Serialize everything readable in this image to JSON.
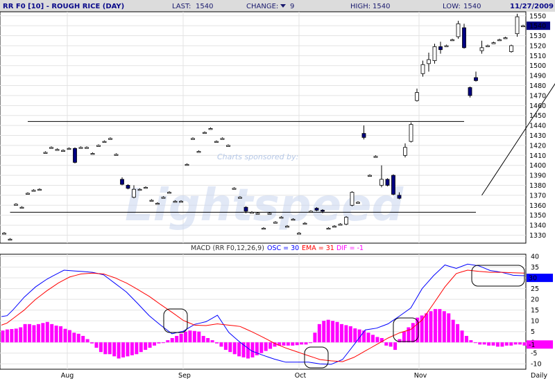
{
  "header": {
    "title": "RR F0 [10] - ROUGH RICE (DAY)",
    "last_label": "LAST:",
    "last_value": "1540",
    "change_label": "CHANGE:",
    "change_value": "9",
    "change_direction": "down",
    "high_label": "HIGH:",
    "high_value": "1540",
    "low_label": "LOW:",
    "low_value": "1540",
    "date": "11/27/2009"
  },
  "watermark": {
    "sponsor": "Charts sponsored by:",
    "brand": "Lightspeed"
  },
  "macd_legend": {
    "prefix": "MACD (RR F0,12,26,9)",
    "osc": "OSC = 30",
    "ema": "EMA = 31",
    "dif": "DIF = -1"
  },
  "colors": {
    "header_bg": "#dcdcdc",
    "up_candle": "#ffffff",
    "down_candle": "#000080",
    "macd_line": "#0000ff",
    "signal_line": "#ff0000",
    "histogram": "#ff00ff",
    "current_price_box": "#000080"
  },
  "chart_data": [
    {
      "type": "candlestick",
      "title": "RR F0 [10] - ROUGH RICE (DAY)",
      "y_ticks": [
        1330,
        1340,
        1350,
        1360,
        1370,
        1380,
        1390,
        1400,
        1410,
        1420,
        1430,
        1440,
        1450,
        1460,
        1470,
        1480,
        1490,
        1500,
        1510,
        1520,
        1530,
        1540,
        1550
      ],
      "ylim": [
        1322,
        1554
      ],
      "x_tick_labels": [
        "Aug",
        "Sep",
        "Oct",
        "Nov",
        "Daily"
      ],
      "current_price_label": "1540",
      "trendlines": [
        {
          "name": "resistance",
          "from": {
            "bar": 4,
            "price": 1444
          },
          "to": {
            "bar": 78,
            "price": 1444
          }
        },
        {
          "name": "support",
          "from": {
            "bar": 1,
            "price": 1353
          },
          "to": {
            "bar": 80,
            "price": 1353
          }
        },
        {
          "name": "uptrend",
          "from": {
            "bar": 81,
            "price": 1370
          },
          "to": {
            "bar": 99,
            "price": 1532
          }
        }
      ],
      "candles": [
        {
          "o": 1332,
          "h": 1333,
          "l": 1331,
          "c": 1332
        },
        {
          "o": 1326,
          "h": 1327,
          "l": 1325,
          "c": 1326
        },
        {
          "o": 1361,
          "h": 1362,
          "l": 1360,
          "c": 1361
        },
        {
          "o": 1358,
          "h": 1359,
          "l": 1357,
          "c": 1358
        },
        {
          "o": 1372,
          "h": 1373,
          "l": 1371,
          "c": 1372
        },
        {
          "o": 1375,
          "h": 1376,
          "l": 1374,
          "c": 1375
        },
        {
          "o": 1376,
          "h": 1377,
          "l": 1375,
          "c": 1376
        },
        {
          "o": 1413,
          "h": 1414,
          "l": 1412,
          "c": 1413
        },
        {
          "o": 1418,
          "h": 1419,
          "l": 1417,
          "c": 1418
        },
        {
          "o": 1416,
          "h": 1417,
          "l": 1415,
          "c": 1416
        },
        {
          "o": 1415,
          "h": 1416,
          "l": 1414,
          "c": 1415
        },
        {
          "o": 1417,
          "h": 1418,
          "l": 1416,
          "c": 1417
        },
        {
          "o": 1417,
          "h": 1418,
          "l": 1402,
          "c": 1403
        },
        {
          "o": 1418,
          "h": 1419,
          "l": 1417,
          "c": 1418
        },
        {
          "o": 1418,
          "h": 1419,
          "l": 1417,
          "c": 1418
        },
        {
          "o": 1412,
          "h": 1413,
          "l": 1411,
          "c": 1412
        },
        {
          "o": 1420,
          "h": 1421,
          "l": 1419,
          "c": 1420
        },
        {
          "o": 1424,
          "h": 1425,
          "l": 1423,
          "c": 1424
        },
        {
          "o": 1427,
          "h": 1428,
          "l": 1426,
          "c": 1427
        },
        {
          "o": 1411,
          "h": 1412,
          "l": 1410,
          "c": 1411
        },
        {
          "o": 1386,
          "h": 1388,
          "l": 1380,
          "c": 1381
        },
        {
          "o": 1380,
          "h": 1381,
          "l": 1376,
          "c": 1377
        },
        {
          "o": 1368,
          "h": 1380,
          "l": 1367,
          "c": 1376
        },
        {
          "o": 1376,
          "h": 1377,
          "l": 1375,
          "c": 1376
        },
        {
          "o": 1378,
          "h": 1379,
          "l": 1377,
          "c": 1378
        },
        {
          "o": 1365,
          "h": 1366,
          "l": 1364,
          "c": 1365
        },
        {
          "o": 1362,
          "h": 1363,
          "l": 1361,
          "c": 1362
        },
        {
          "o": 1368,
          "h": 1369,
          "l": 1367,
          "c": 1368
        },
        {
          "o": 1373,
          "h": 1374,
          "l": 1372,
          "c": 1373
        },
        {
          "o": 1364,
          "h": 1365,
          "l": 1363,
          "c": 1364
        },
        {
          "o": 1364,
          "h": 1365,
          "l": 1363,
          "c": 1364
        },
        {
          "o": 1401,
          "h": 1402,
          "l": 1400,
          "c": 1401
        },
        {
          "o": 1427,
          "h": 1428,
          "l": 1426,
          "c": 1427
        },
        {
          "o": 1414,
          "h": 1415,
          "l": 1413,
          "c": 1414
        },
        {
          "o": 1433,
          "h": 1434,
          "l": 1432,
          "c": 1433
        },
        {
          "o": 1437,
          "h": 1438,
          "l": 1436,
          "c": 1437
        },
        {
          "o": 1424,
          "h": 1425,
          "l": 1423,
          "c": 1424
        },
        {
          "o": 1427,
          "h": 1428,
          "l": 1426,
          "c": 1427
        },
        {
          "o": 1420,
          "h": 1421,
          "l": 1419,
          "c": 1420
        },
        {
          "o": 1377,
          "h": 1378,
          "l": 1376,
          "c": 1377
        },
        {
          "o": 1368,
          "h": 1369,
          "l": 1367,
          "c": 1368
        },
        {
          "o": 1358,
          "h": 1359,
          "l": 1352,
          "c": 1354
        },
        {
          "o": 1353,
          "h": 1354,
          "l": 1352,
          "c": 1353
        },
        {
          "o": 1352,
          "h": 1353,
          "l": 1351,
          "c": 1352
        },
        {
          "o": 1337,
          "h": 1338,
          "l": 1336,
          "c": 1337
        },
        {
          "o": 1352,
          "h": 1353,
          "l": 1351,
          "c": 1352
        },
        {
          "o": 1343,
          "h": 1344,
          "l": 1342,
          "c": 1343
        },
        {
          "o": 1348,
          "h": 1349,
          "l": 1347,
          "c": 1348
        },
        {
          "o": 1339,
          "h": 1340,
          "l": 1338,
          "c": 1339
        },
        {
          "o": 1346,
          "h": 1347,
          "l": 1345,
          "c": 1346
        },
        {
          "o": 1332,
          "h": 1333,
          "l": 1331,
          "c": 1332
        },
        {
          "o": 1342,
          "h": 1343,
          "l": 1341,
          "c": 1342
        },
        {
          "o": 1354,
          "h": 1355,
          "l": 1353,
          "c": 1354
        },
        {
          "o": 1357,
          "h": 1358,
          "l": 1354,
          "c": 1355
        },
        {
          "o": 1355,
          "h": 1356,
          "l": 1352,
          "c": 1354
        },
        {
          "o": 1337,
          "h": 1338,
          "l": 1336,
          "c": 1337
        },
        {
          "o": 1339,
          "h": 1340,
          "l": 1338,
          "c": 1339
        },
        {
          "o": 1341,
          "h": 1342,
          "l": 1340,
          "c": 1341
        },
        {
          "o": 1341,
          "h": 1349,
          "l": 1340,
          "c": 1348
        },
        {
          "o": 1360,
          "h": 1374,
          "l": 1359,
          "c": 1373
        },
        {
          "o": 1363,
          "h": 1364,
          "l": 1362,
          "c": 1363
        },
        {
          "o": 1432,
          "h": 1440,
          "l": 1426,
          "c": 1428
        },
        {
          "o": 1390,
          "h": 1391,
          "l": 1389,
          "c": 1390
        },
        {
          "o": 1409,
          "h": 1410,
          "l": 1408,
          "c": 1409
        },
        {
          "o": 1380,
          "h": 1400,
          "l": 1378,
          "c": 1386
        },
        {
          "o": 1386,
          "h": 1387,
          "l": 1379,
          "c": 1380
        },
        {
          "o": 1390,
          "h": 1391,
          "l": 1370,
          "c": 1371
        },
        {
          "o": 1370,
          "h": 1373,
          "l": 1366,
          "c": 1367
        },
        {
          "o": 1410,
          "h": 1422,
          "l": 1408,
          "c": 1418
        },
        {
          "o": 1424,
          "h": 1443,
          "l": 1423,
          "c": 1441
        },
        {
          "o": 1465,
          "h": 1477,
          "l": 1464,
          "c": 1473
        },
        {
          "o": 1492,
          "h": 1505,
          "l": 1489,
          "c": 1501
        },
        {
          "o": 1502,
          "h": 1513,
          "l": 1494,
          "c": 1506
        },
        {
          "o": 1505,
          "h": 1522,
          "l": 1502,
          "c": 1519
        },
        {
          "o": 1519,
          "h": 1524,
          "l": 1512,
          "c": 1516
        },
        {
          "o": 1520,
          "h": 1521,
          "l": 1519,
          "c": 1520
        },
        {
          "o": 1526,
          "h": 1527,
          "l": 1525,
          "c": 1526
        },
        {
          "o": 1529,
          "h": 1545,
          "l": 1527,
          "c": 1542
        },
        {
          "o": 1538,
          "h": 1542,
          "l": 1517,
          "c": 1518
        },
        {
          "o": 1478,
          "h": 1479,
          "l": 1468,
          "c": 1470
        },
        {
          "o": 1488,
          "h": 1494,
          "l": 1484,
          "c": 1485
        },
        {
          "o": 1515,
          "h": 1525,
          "l": 1512,
          "c": 1518
        },
        {
          "o": 1520,
          "h": 1521,
          "l": 1519,
          "c": 1520
        },
        {
          "o": 1523,
          "h": 1524,
          "l": 1522,
          "c": 1523
        },
        {
          "o": 1526,
          "h": 1527,
          "l": 1525,
          "c": 1526
        },
        {
          "o": 1528,
          "h": 1529,
          "l": 1527,
          "c": 1528
        },
        {
          "o": 1514,
          "h": 1521,
          "l": 1513,
          "c": 1520
        },
        {
          "o": 1532,
          "h": 1552,
          "l": 1529,
          "c": 1549
        },
        {
          "o": 1540,
          "h": 1541,
          "l": 1539,
          "c": 1540
        }
      ]
    },
    {
      "type": "macd",
      "title": "MACD (RR F0,12,26,9)",
      "params": [
        12,
        26,
        9
      ],
      "y_ticks": [
        -10,
        -5,
        0,
        5,
        10,
        15,
        20,
        25,
        30,
        35,
        40
      ],
      "ylim": [
        -12.5,
        41
      ],
      "x_tick_labels": [
        "Aug",
        "Sep",
        "Oct",
        "Nov",
        "Daily"
      ],
      "current_labels": {
        "osc": "30",
        "dif": "-1"
      },
      "series": [
        {
          "name": "OSC",
          "color": "#0000ff",
          "values": [
            12,
            12.4,
            15,
            18,
            21,
            23.4,
            25.8,
            27.6,
            29.4,
            30.8,
            32.2,
            33.6,
            33.4,
            33.2,
            33,
            32.8,
            32.6,
            32,
            31.4,
            29.4,
            27.4,
            25.4,
            23.4,
            20.7,
            18,
            15.2,
            12.4,
            10.2,
            8,
            6,
            4,
            4.6,
            5.2,
            6.8,
            8.4,
            9,
            9.6,
            11.1,
            12.6,
            8.6,
            4.6,
            2.3,
            0,
            -2,
            -4,
            -5,
            -6,
            -6.9,
            -7.8,
            -8.5,
            -9.2,
            -9.2,
            -9.2,
            -9.2,
            -9.2,
            -9.6,
            -10,
            -10.1,
            -10.2,
            -9.1,
            -8,
            -4.6,
            -1.2,
            2.3,
            5.8,
            6.2,
            6.6,
            7.6,
            8.6,
            10.4,
            12.2,
            14.1,
            16,
            20.5,
            25,
            28,
            31,
            33.5,
            36,
            35.2,
            34.4,
            35.4,
            36.4,
            36,
            35.6,
            34.5,
            33.4,
            33,
            32.6,
            31.9,
            31.2,
            31.1,
            31
          ]
        },
        {
          "name": "EMA",
          "color": "#ff0000",
          "values": [
            8,
            9,
            11,
            13,
            15,
            17.5,
            20,
            22,
            24,
            25.8,
            27.6,
            29,
            30.4,
            31.1,
            31.8,
            32,
            32.2,
            32,
            31.8,
            30.9,
            30,
            28.8,
            27.6,
            26.1,
            24.6,
            23,
            21.4,
            19.5,
            17.6,
            15.8,
            14,
            12.1,
            10.2,
            9.1,
            8,
            7.9,
            7.8,
            8.2,
            8.6,
            8.3,
            8,
            7.7,
            7.4,
            6.2,
            5,
            3.7,
            2.4,
            1,
            -0.4,
            -1.5,
            -2.6,
            -3.5,
            -4.4,
            -5.3,
            -6.2,
            -7.1,
            -8,
            -8.3,
            -8.6,
            -8.8,
            -9,
            -8,
            -7,
            -5.5,
            -4,
            -2.5,
            -1,
            0.5,
            2,
            3.2,
            4.4,
            5.2,
            6,
            8.2,
            10.4,
            14.2,
            18,
            21.9,
            25.8,
            28.9,
            32,
            32.8,
            33.6,
            33.3,
            33,
            32.8,
            32.6,
            32.6,
            32.6,
            32.5,
            32.4,
            32.3,
            32.2
          ]
        },
        {
          "name": "DIF",
          "color": "#ff00ff",
          "values": [
            5.5,
            6,
            6.2,
            6.4,
            7,
            8.5,
            8.5,
            8,
            8.5,
            9,
            9.5,
            8.5,
            7.8,
            7.5,
            6.3,
            5.7,
            4.5,
            4,
            3,
            1.5,
            -0.5,
            -2.5,
            -4.5,
            -5.5,
            -5.5,
            -6.5,
            -7.5,
            -7,
            -6.5,
            -6,
            -5.5,
            -4.5,
            -3.5,
            -2.5,
            -1.5,
            -0.5,
            0,
            1,
            2,
            3,
            4,
            5,
            5.5,
            5.3,
            5,
            3,
            2,
            1,
            -0.5,
            -2,
            -3.5,
            -4.5,
            -5.5,
            -6.5,
            -7,
            -7.5,
            -7,
            -6,
            -5,
            -4,
            -3,
            -2,
            -1.5,
            -1.5,
            -1.5,
            -1.5,
            -1.3,
            -1,
            -1,
            -0.2,
            4.5,
            8.5,
            10,
            10.5,
            10,
            9.5,
            8.5,
            8,
            7.5,
            6.5,
            6,
            5.5,
            4.5,
            3.5,
            2.5,
            2,
            -1.5,
            -2,
            -3.5,
            1.5,
            5,
            7,
            9,
            11.5,
            12.5,
            13.5,
            14.5,
            15.5,
            15.5,
            14.5,
            13.5,
            10.5,
            8.5,
            5.5,
            3,
            1,
            0,
            -1,
            -1,
            -1.5,
            -1.5,
            -2,
            -2,
            -1.5,
            -1.5,
            -1,
            -1,
            -1.5
          ]
        }
      ],
      "highlight_circles": [
        "Sep",
        "Oct",
        "Oct-Nov",
        "Nov-end"
      ]
    }
  ]
}
